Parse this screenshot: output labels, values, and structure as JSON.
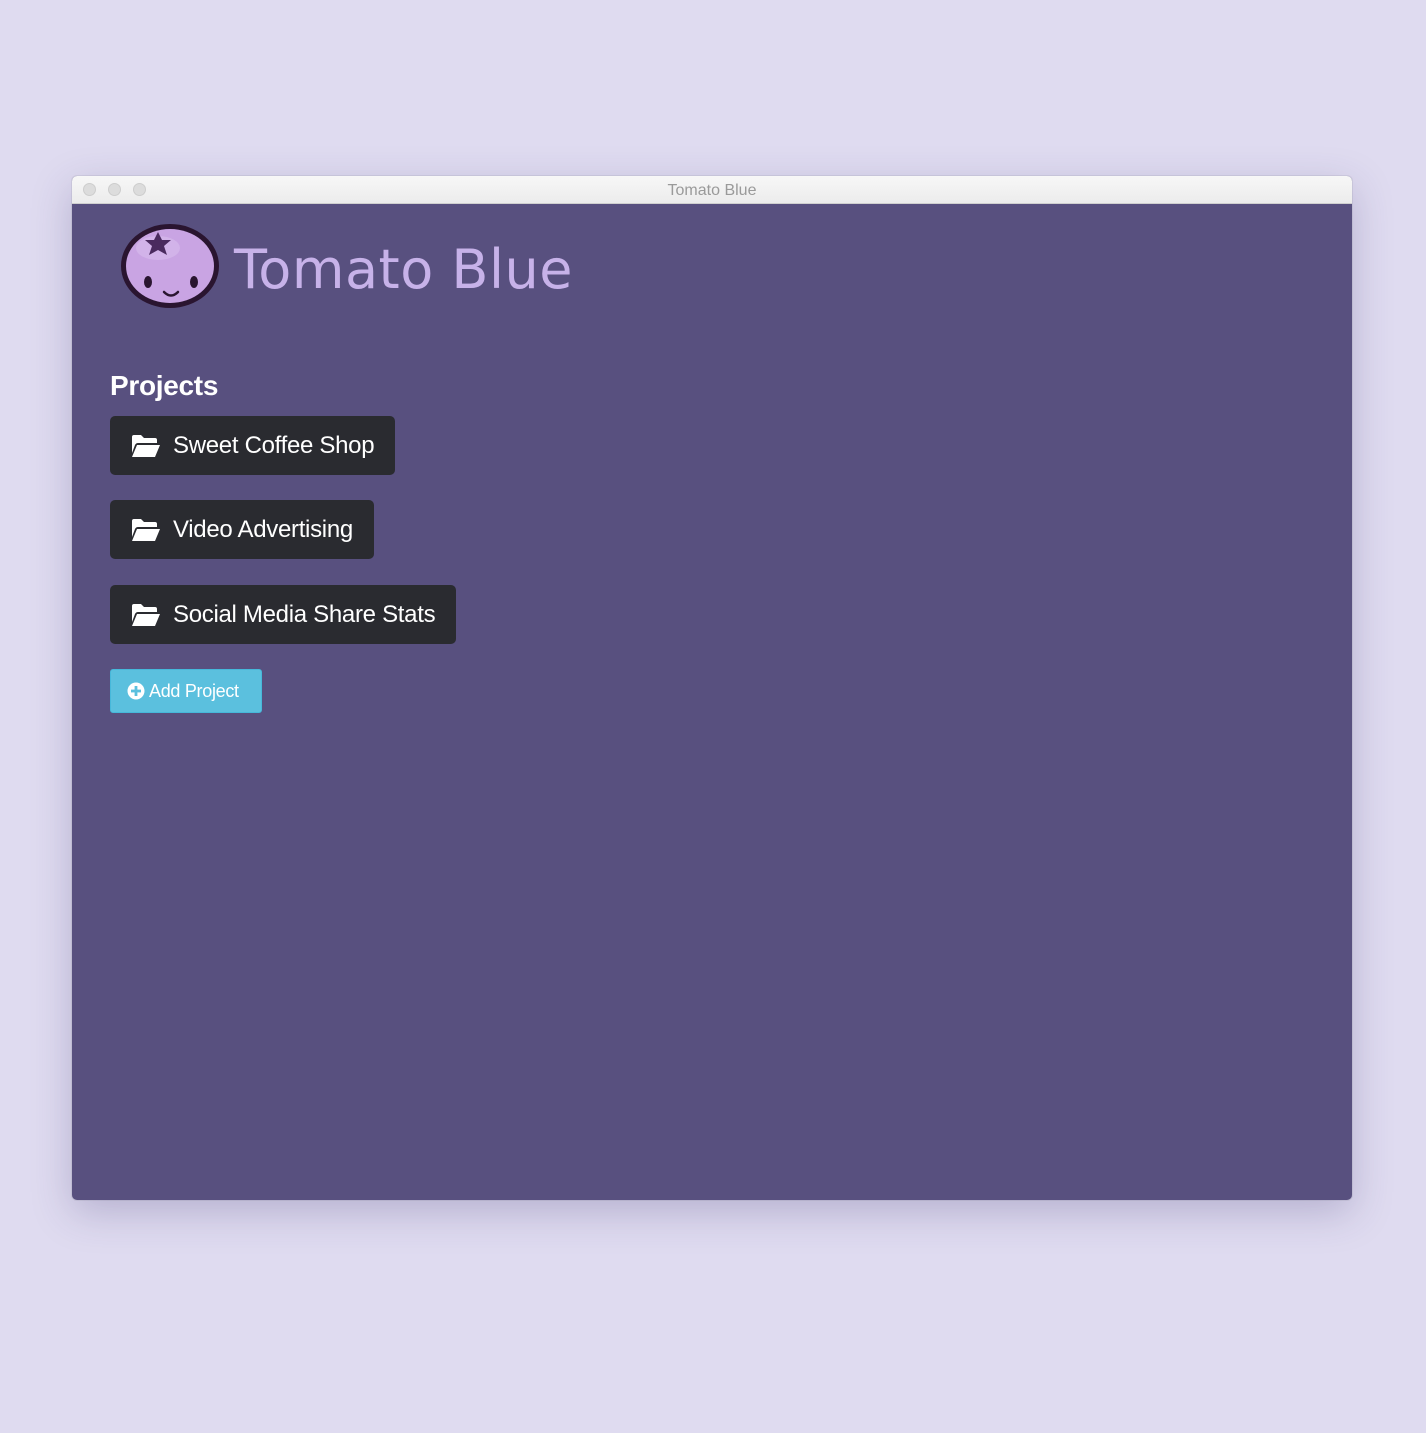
{
  "window": {
    "title": "Tomato Blue"
  },
  "brand": {
    "name": "Tomato Blue",
    "logo_icon": "blueberry-face-icon"
  },
  "projects": {
    "heading": "Projects",
    "items": [
      {
        "label": "Sweet Coffee Shop",
        "icon": "folder-open-icon"
      },
      {
        "label": "Video Advertising",
        "icon": "folder-open-icon"
      },
      {
        "label": "Social Media Share Stats",
        "icon": "folder-open-icon"
      }
    ],
    "add_button": {
      "label": "Add Project",
      "icon": "plus-circle-icon"
    }
  },
  "colors": {
    "desktop_background": "#dfdbf0",
    "app_background": "#58507f",
    "brand_text": "#c7b2e9",
    "project_button": "#2a2b30",
    "add_button": "#5bc0de"
  }
}
